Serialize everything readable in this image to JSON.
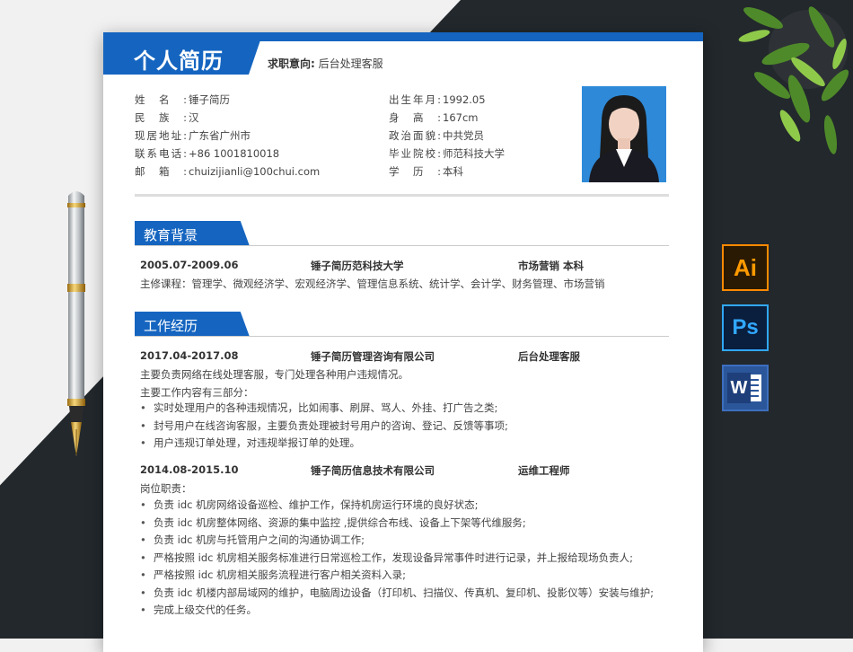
{
  "resume": {
    "title": "个人简历",
    "intent_label": "求职意向:",
    "intent_value": "后台处理客服",
    "left_info": [
      {
        "label": "姓名:",
        "value": "锤子简历"
      },
      {
        "label": "民族:",
        "value": "汉"
      },
      {
        "label": "现居地址:",
        "value": "广东省广州市"
      },
      {
        "label": "联系电话:",
        "value": "+86 1001810018"
      },
      {
        "label": "邮箱:",
        "value": "chuizijianli@100chui.com"
      }
    ],
    "right_info": [
      {
        "label": "出生年月:",
        "value": "1992.05"
      },
      {
        "label": "身高:",
        "value": "167cm"
      },
      {
        "label": "政治面貌:",
        "value": "中共党员"
      },
      {
        "label": "毕业院校:",
        "value": "师范科技大学"
      },
      {
        "label": "学历:",
        "value": "本科"
      }
    ],
    "education": {
      "heading": "教育背景",
      "date": "2005.07-2009.06",
      "school": "锤子简历范科技大学",
      "major": "市场营销  本科",
      "courses": "主修课程：管理学、微观经济学、宏观经济学、管理信息系统、统计学、会计学、财务管理、市场营销"
    },
    "work": {
      "heading": "工作经历",
      "jobs": [
        {
          "date": "2017.04-2017.08",
          "company": "锤子简历管理咨询有限公司",
          "position": "后台处理客服",
          "lines": [
            "主要负责网络在线处理客服，专门处理各种用户违规情况。",
            "主要工作内容有三部分："
          ],
          "bullets": [
            "实时处理用户的各种违规情况，比如闹事、刷屏、骂人、外挂、打广告之类;",
            "封号用户在线咨询客服，主要负责处理被封号用户的咨询、登记、反馈等事项;",
            "用户违规订单处理，对违规举报订单的处理。"
          ]
        },
        {
          "date": "2014.08-2015.10",
          "company": "锤子简历信息技术有限公司",
          "position": "运维工程师",
          "lines": [
            "岗位职责："
          ],
          "bullets": [
            "负责 idc 机房网络设备巡检、维护工作，保持机房运行环境的良好状态;",
            "负责 idc 机房整体网络、资源的集中监控 ,提供综合布线、设备上下架等代维服务;",
            "负责 idc 机房与托管用户之间的沟通协调工作;",
            "严格按照 idc 机房相关服务标准进行日常巡检工作，发现设备异常事件时进行记录，并上报给现场负责人;",
            "严格按照 idc 机房相关服务流程进行客户相关资料入录;",
            "负责 idc 机楼内部局域网的维护，电脑周边设备（打印机、扫描仪、传真机、复印机、投影仪等）安装与维护;",
            "完成上级交代的任务。"
          ]
        }
      ]
    }
  },
  "app_icons": {
    "ai": "Ai",
    "ps": "Ps",
    "word": "W"
  },
  "colors": {
    "brand_blue": "#1565c0",
    "dark_bg": "#22282c"
  }
}
